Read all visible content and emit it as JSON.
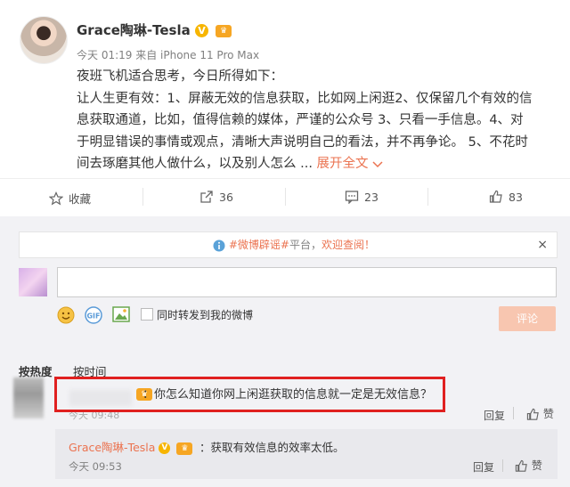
{
  "post": {
    "author": "Grace陶琳-Tesla",
    "verified_mark": "V",
    "meta": "今天 01:19 来自 iPhone 11 Pro Max",
    "line1": "夜班飞机适合思考，今日所得如下：",
    "line2": "让人生更有效：1、屏蔽无效的信息获取，比如网上闲逛2、仅保留几个有效的信",
    "line3": "息获取通道，比如，值得信赖的媒体，严谨的公众号   3、只看一手信息。4、对",
    "line4": "于明显错误的事情或观点，清晰大声说明自己的看法，并不再争论。 5、不花时",
    "line5": "间去琢磨其他人做什么，以及别人怎么 ...",
    "expand_label": "展开全文"
  },
  "actions": {
    "favorite": "收藏",
    "repost_count": "36",
    "comment_count": "23",
    "like_count": "83"
  },
  "notice": {
    "tag": "#微博辟谣#",
    "mid": "平台，",
    "link": "欢迎查阅！",
    "close": "×"
  },
  "composer": {
    "repost_option": "同时转发到我的微博",
    "submit": "评论"
  },
  "sort": {
    "hot": "按热度",
    "time": "按时间"
  },
  "comment": {
    "text": "：你怎么知道你网上闲逛获取的信息就一定是无效信息？",
    "time": "今天 09:48",
    "reply": "回复",
    "like": "赞"
  },
  "sub_comment": {
    "author": "Grace陶琳-Tesla",
    "text": "：获取有效信息的效率太低。",
    "time": "今天 09:53",
    "reply": "回复",
    "like": "赞"
  },
  "colors": {
    "accent": "#eb7350",
    "highlight_box": "#e02020",
    "vip": "#f7b500"
  },
  "icons": [
    "star-icon",
    "repost-icon",
    "comment-icon",
    "like-icon",
    "info-icon",
    "smiley-icon",
    "gif-icon",
    "image-icon",
    "chevron-down-icon"
  ]
}
